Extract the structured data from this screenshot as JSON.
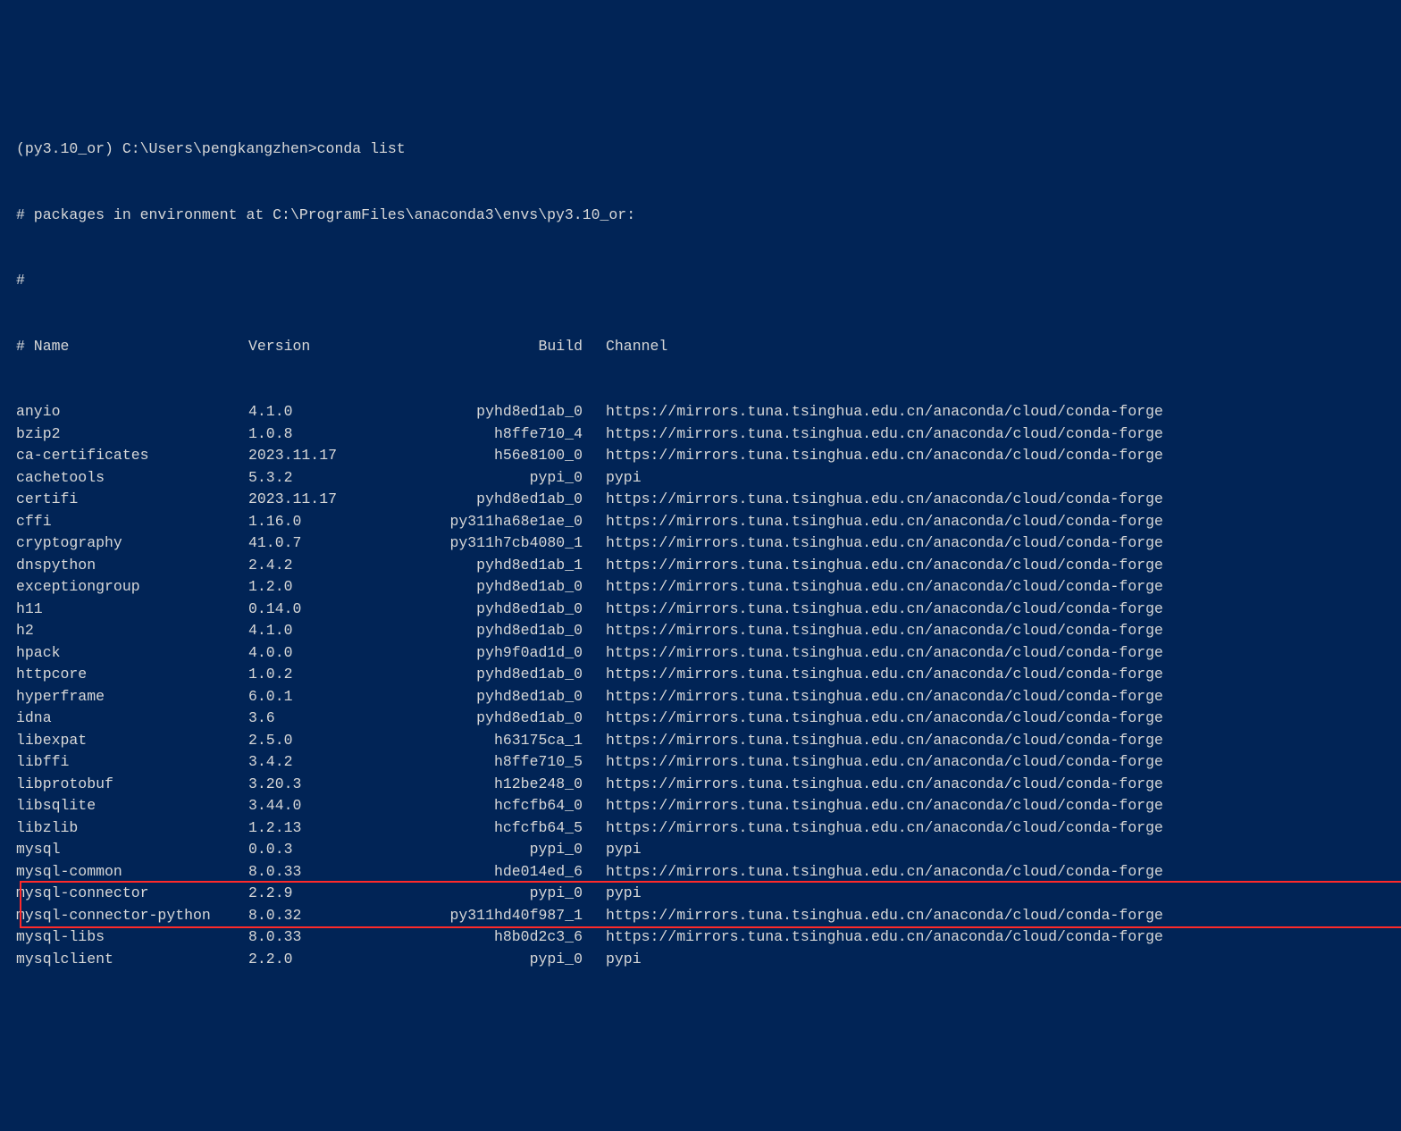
{
  "prompt_line": "(py3.10_or) C:\\Users\\pengkangzhen>conda list",
  "env_comment": "# packages in environment at C:\\ProgramFiles\\anaconda3\\envs\\py3.10_or:",
  "hash_line": "#",
  "header": {
    "name": "# Name",
    "version": "Version",
    "build": "Build",
    "channel": "Channel"
  },
  "conda_forge": "https://mirrors.tuna.tsinghua.edu.cn/anaconda/cloud/conda-forge",
  "pypi": "pypi",
  "packages": [
    {
      "name": "anyio",
      "version": "4.1.0",
      "build": "pyhd8ed1ab_0",
      "channel_key": "conda_forge"
    },
    {
      "name": "bzip2",
      "version": "1.0.8",
      "build": "h8ffe710_4",
      "channel_key": "conda_forge"
    },
    {
      "name": "ca-certificates",
      "version": "2023.11.17",
      "build": "h56e8100_0",
      "channel_key": "conda_forge"
    },
    {
      "name": "cachetools",
      "version": "5.3.2",
      "build": "pypi_0",
      "channel_key": "pypi"
    },
    {
      "name": "certifi",
      "version": "2023.11.17",
      "build": "pyhd8ed1ab_0",
      "channel_key": "conda_forge"
    },
    {
      "name": "cffi",
      "version": "1.16.0",
      "build": "py311ha68e1ae_0",
      "channel_key": "conda_forge"
    },
    {
      "name": "cryptography",
      "version": "41.0.7",
      "build": "py311h7cb4080_1",
      "channel_key": "conda_forge"
    },
    {
      "name": "dnspython",
      "version": "2.4.2",
      "build": "pyhd8ed1ab_1",
      "channel_key": "conda_forge"
    },
    {
      "name": "exceptiongroup",
      "version": "1.2.0",
      "build": "pyhd8ed1ab_0",
      "channel_key": "conda_forge"
    },
    {
      "name": "h11",
      "version": "0.14.0",
      "build": "pyhd8ed1ab_0",
      "channel_key": "conda_forge"
    },
    {
      "name": "h2",
      "version": "4.1.0",
      "build": "pyhd8ed1ab_0",
      "channel_key": "conda_forge"
    },
    {
      "name": "hpack",
      "version": "4.0.0",
      "build": "pyh9f0ad1d_0",
      "channel_key": "conda_forge"
    },
    {
      "name": "httpcore",
      "version": "1.0.2",
      "build": "pyhd8ed1ab_0",
      "channel_key": "conda_forge"
    },
    {
      "name": "hyperframe",
      "version": "6.0.1",
      "build": "pyhd8ed1ab_0",
      "channel_key": "conda_forge"
    },
    {
      "name": "idna",
      "version": "3.6",
      "build": "pyhd8ed1ab_0",
      "channel_key": "conda_forge"
    },
    {
      "name": "libexpat",
      "version": "2.5.0",
      "build": "h63175ca_1",
      "channel_key": "conda_forge"
    },
    {
      "name": "libffi",
      "version": "3.4.2",
      "build": "h8ffe710_5",
      "channel_key": "conda_forge"
    },
    {
      "name": "libprotobuf",
      "version": "3.20.3",
      "build": "h12be248_0",
      "channel_key": "conda_forge"
    },
    {
      "name": "libsqlite",
      "version": "3.44.0",
      "build": "hcfcfb64_0",
      "channel_key": "conda_forge"
    },
    {
      "name": "libzlib",
      "version": "1.2.13",
      "build": "hcfcfb64_5",
      "channel_key": "conda_forge"
    },
    {
      "name": "mysql",
      "version": "0.0.3",
      "build": "pypi_0",
      "channel_key": "pypi"
    },
    {
      "name": "mysql-common",
      "version": "8.0.33",
      "build": "hde014ed_6",
      "channel_key": "conda_forge"
    },
    {
      "name": "mysql-connector",
      "version": "2.2.9",
      "build": "pypi_0",
      "channel_key": "pypi",
      "highlight": true
    },
    {
      "name": "mysql-connector-python",
      "version": "8.0.32",
      "build": "py311hd40f987_1",
      "channel_key": "conda_forge",
      "highlight": true
    },
    {
      "name": "mysql-libs",
      "version": "8.0.33",
      "build": "h8b0d2c3_6",
      "channel_key": "conda_forge"
    },
    {
      "name": "mysqlclient",
      "version": "2.2.0",
      "build": "pypi_0",
      "channel_key": "pypi"
    }
  ]
}
